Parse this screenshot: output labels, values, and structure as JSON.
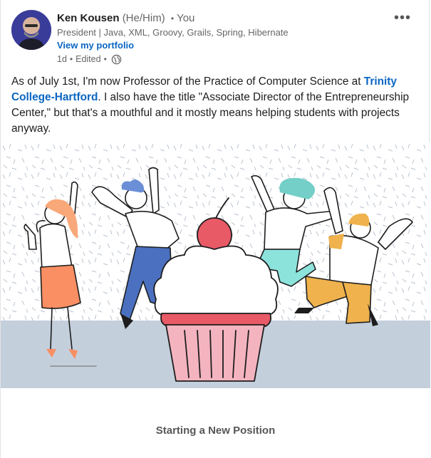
{
  "author": {
    "name": "Ken Kousen",
    "pronouns": "(He/Him)",
    "relation": "You",
    "headline": "President | Java, XML, Groovy, Grails, Spring, Hibernate",
    "portfolio_link": "View my portfolio",
    "avatar_icon": "profile-photo"
  },
  "post_meta": {
    "age": "1d",
    "edited": "Edited",
    "visibility_icon": "globe-icon"
  },
  "menu_icon": "more-options-icon",
  "post": {
    "text_before": "As of July 1st, I'm now Professor of the Practice of Computer Science at ",
    "link_text": "Trinity College-Hartford",
    "text_after": ". I also have the title \"Associate Director of the Entrepreneurship Center,\" but that's a mouthful and it mostly means helping students with projects anyway."
  },
  "media": {
    "caption": "Starting a New Position",
    "colors": {
      "cupcake_frosting": "#ffffff",
      "cupcake_base": "#f4b4bf",
      "cherry": "#e85a66",
      "floor": "#c4cfdc",
      "orange_person": "#f98f63",
      "blue_person": "#4a70bf",
      "teal_person": "#8ce3dc",
      "yellow_person": "#efb24c"
    }
  }
}
